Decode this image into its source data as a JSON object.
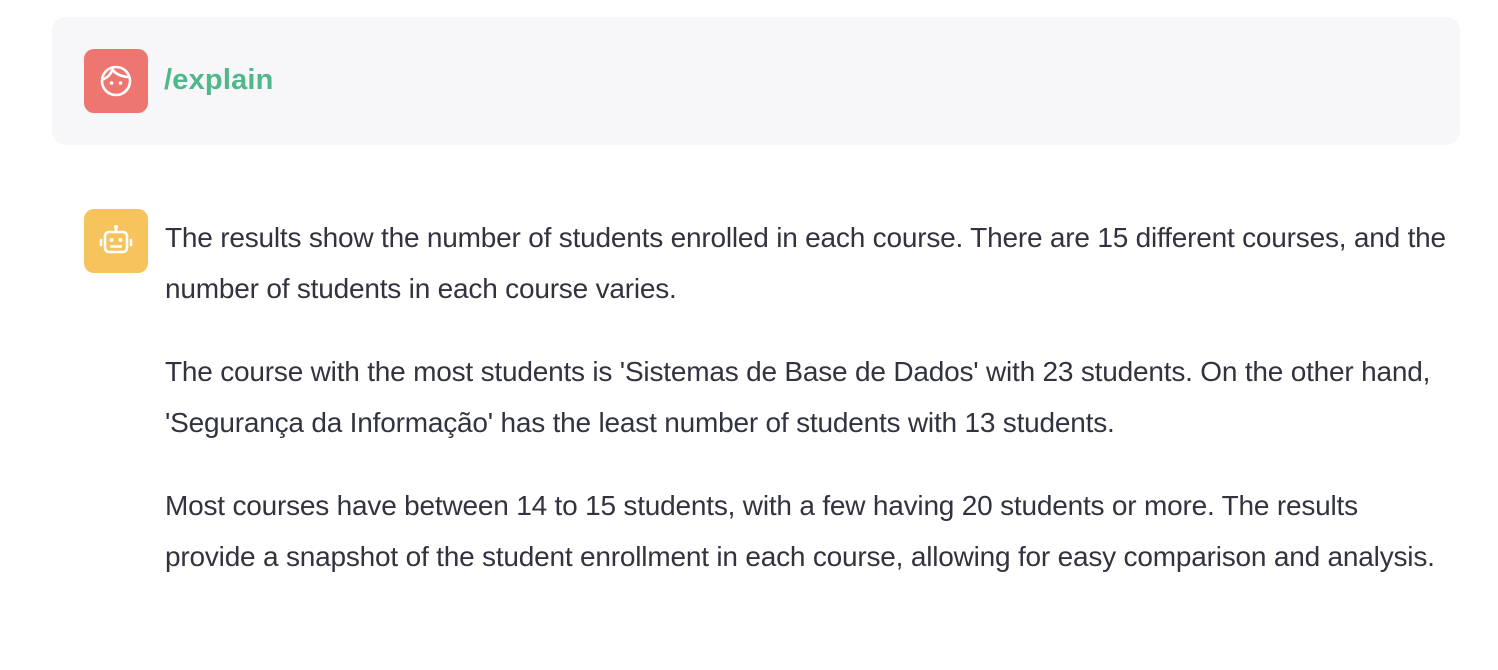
{
  "colors": {
    "user_avatar_bg": "#ee7670",
    "bot_avatar_bg": "#f7c35c",
    "command_text": "#4fb88b",
    "body_text": "#31333f",
    "user_bubble_bg": "#f7f7f9"
  },
  "user_message": {
    "avatar_icon": "face-icon",
    "text": "/explain"
  },
  "assistant_message": {
    "avatar_icon": "robot-icon",
    "paragraphs": [
      "The results show the number of students enrolled in each course. There are 15 different courses, and the number of students in each course varies.",
      "The course with the most students is 'Sistemas de Base de Dados' with 23 students. On the other hand, 'Segurança da Informação' has the least number of students with 13 students.",
      "Most courses have between 14 to 15 students, with a few having 20 students or more. The results provide a snapshot of the student enrollment in each course, allowing for easy comparison and analysis."
    ]
  }
}
